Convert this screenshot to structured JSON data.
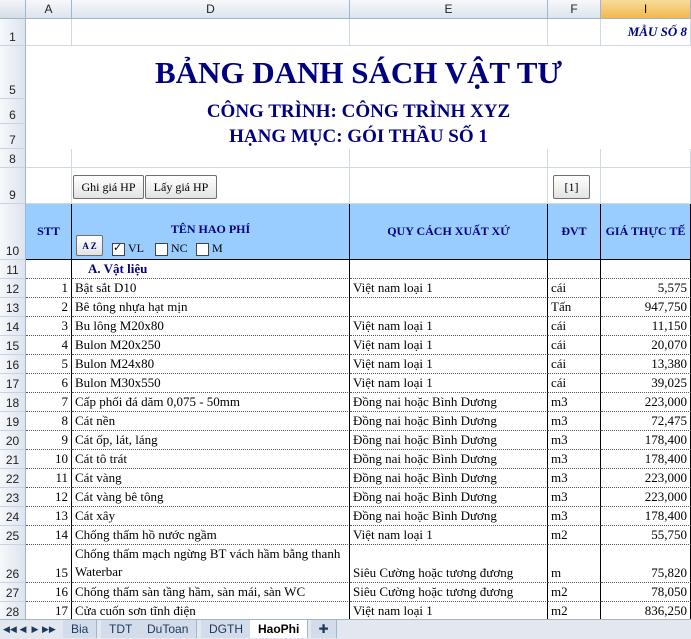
{
  "columns": [
    "A",
    "D",
    "E",
    "F",
    "I"
  ],
  "form_code": "MẪU SỐ 8",
  "title": "BẢNG DANH SÁCH VẬT TƯ",
  "project": "CÔNG TRÌNH: CÔNG TRÌNH XYZ",
  "category": "HẠNG MỤC: GÓI THẦU SỐ 1",
  "buttons": {
    "ghi_gia": "Ghi giá HP",
    "lay_gia": "Lấy giá HP",
    "page": "[1]",
    "sort": "A Z"
  },
  "filters": [
    {
      "label": "VL",
      "checked": true
    },
    {
      "label": "NC",
      "checked": false
    },
    {
      "label": "M",
      "checked": false
    }
  ],
  "headers": {
    "stt": "STT",
    "name": "TÊN HAO PHÍ",
    "spec": "QUY CÁCH XUẤT XỨ",
    "unit": "ĐVT",
    "price": "GIÁ THỰC TẾ"
  },
  "row_numbers": [
    "1",
    "5",
    "6",
    "7",
    "8",
    "9",
    "10",
    "11",
    "12",
    "13",
    "14",
    "15",
    "16",
    "17",
    "18",
    "19",
    "20",
    "21",
    "22",
    "23",
    "24",
    "25",
    "26",
    "27",
    "28"
  ],
  "section_label": "A. Vật liệu",
  "rows": [
    {
      "stt": "1",
      "name": "Bật sắt D10",
      "spec": "Việt nam loại 1",
      "unit": "cái",
      "price": "5,575"
    },
    {
      "stt": "2",
      "name": "Bê tông nhựa hạt mịn",
      "spec": "",
      "unit": "Tấn",
      "price": "947,750"
    },
    {
      "stt": "3",
      "name": "Bu lông M20x80",
      "spec": "Việt nam loại 1",
      "unit": "cái",
      "price": "11,150"
    },
    {
      "stt": "4",
      "name": "Bulon M20x250",
      "spec": "Việt nam loại 1",
      "unit": "cái",
      "price": "20,070"
    },
    {
      "stt": "5",
      "name": "Bulon M24x80",
      "spec": "Việt nam loại 1",
      "unit": "cái",
      "price": "13,380"
    },
    {
      "stt": "6",
      "name": "Bulon M30x550",
      "spec": "Việt nam loại 1",
      "unit": "cái",
      "price": "39,025"
    },
    {
      "stt": "7",
      "name": "Cấp phối đá dăm 0,075 - 50mm",
      "spec": "Đồng nai hoặc Bình Dương",
      "unit": "m3",
      "price": "223,000"
    },
    {
      "stt": "8",
      "name": "Cát nền",
      "spec": "Đồng nai hoặc Bình Dương",
      "unit": "m3",
      "price": "72,475"
    },
    {
      "stt": "9",
      "name": "Cát ốp, lát, láng",
      "spec": "Đồng nai hoặc Bình Dương",
      "unit": "m3",
      "price": "178,400"
    },
    {
      "stt": "10",
      "name": "Cát tô trát",
      "spec": "Đồng nai hoặc Bình Dương",
      "unit": "m3",
      "price": "178,400"
    },
    {
      "stt": "11",
      "name": "Cát vàng",
      "spec": "Đồng nai hoặc Bình Dương",
      "unit": "m3",
      "price": "223,000"
    },
    {
      "stt": "12",
      "name": "Cát vàng bê tông",
      "spec": "Đồng nai hoặc Bình Dương",
      "unit": "m3",
      "price": "223,000"
    },
    {
      "stt": "13",
      "name": "Cát xây",
      "spec": "Đồng nai hoặc Bình Dương",
      "unit": "m3",
      "price": "178,400"
    },
    {
      "stt": "14",
      "name": "Chống thấm hồ nước ngầm",
      "spec": "Việt nam loại 1",
      "unit": "m2",
      "price": "55,750"
    },
    {
      "stt": "15",
      "name": "Chống thấm mạch ngừng BT vách hầm bằng thanh Waterbar",
      "spec": "Siêu Cường hoặc tương đương",
      "unit": "m",
      "price": "75,820"
    },
    {
      "stt": "16",
      "name": "Chống thấm sàn tầng hầm, sàn mái, sàn WC",
      "spec": "Siêu Cường hoặc tương đương",
      "unit": "m2",
      "price": "78,050"
    },
    {
      "stt": "17",
      "name": "Cửa cuốn sơn tĩnh điện",
      "spec": "Việt nam loại 1",
      "unit": "m2",
      "price": "836,250"
    }
  ],
  "tabs": [
    "Bia",
    "TDT",
    "DuToan",
    "DGTH",
    "HaoPhi"
  ],
  "active_tab": "HaoPhi"
}
